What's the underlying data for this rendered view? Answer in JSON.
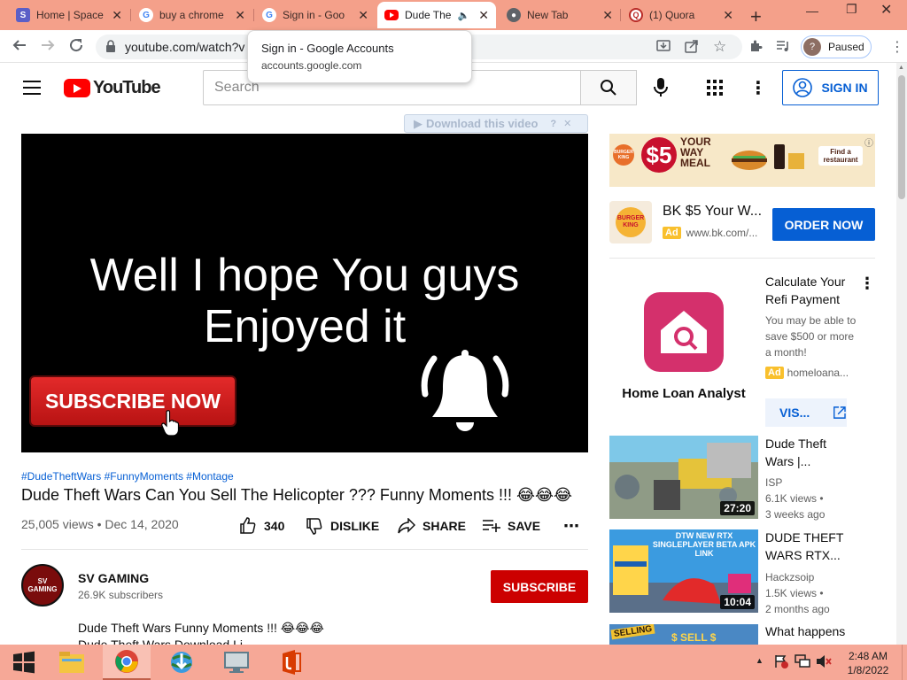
{
  "browser": {
    "tabs": [
      {
        "title": "Home | Space",
        "icon": "teams-icon"
      },
      {
        "title": "buy a chrome",
        "icon": "google-icon"
      },
      {
        "title": "Sign in - Goo",
        "icon": "google-icon"
      },
      {
        "title": "Dude The",
        "icon": "youtube-icon",
        "active": true,
        "audio": true
      },
      {
        "title": "New Tab",
        "icon": "chrome-icon"
      },
      {
        "title": "(1) Quora",
        "icon": "quora-icon"
      }
    ],
    "url": "youtube.com/watch?v",
    "profile_label": "Paused",
    "profile_initial": "?",
    "tooltip": {
      "title": "Sign in - Google Accounts",
      "url": "accounts.google.com"
    }
  },
  "youtube": {
    "logo_text": "YouTube",
    "search_placeholder": "Search",
    "sign_in_label": "SIGN IN",
    "download_bar": "Download this video",
    "video": {
      "overlay_line1": "Well I hope You guys",
      "overlay_line2": "Enjoyed it",
      "subscribe_overlay": "SUBSCRIBE NOW",
      "hashtags": "#DudeTheftWars #FunnyMoments #Montage",
      "title": "Dude Theft Wars Can You Sell The Helicopter ??? Funny Moments !!! 😂😂😂",
      "views_date": "25,005 views • Dec 14, 2020",
      "like_count": "340",
      "dislike_label": "DISLIKE",
      "share_label": "SHARE",
      "save_label": "SAVE"
    },
    "channel": {
      "name": "SV GAMING",
      "subscribers": "26.9K subscribers",
      "subscribe_label": "SUBSCRIBE",
      "avatar_text": "SV GAMING"
    },
    "description": {
      "line1": "Dude Theft Wars Funny Moments !!! 😂😂😂",
      "line2": "Dude Theft Wars Download Li..."
    }
  },
  "ads": {
    "banner": {
      "brand": "BURGER KING",
      "price": "$5",
      "headline1": "YOUR",
      "headline2": "WAY",
      "headline3": "MEAL",
      "cta": "Find a restaurant"
    },
    "bk": {
      "title": "BK $5 Your W...",
      "badge": "Ad",
      "url": "www.bk.com/...",
      "cta": "ORDER NOW",
      "logo_text": "BURGER KING"
    },
    "homeloan": {
      "brand": "Home Loan Analyst",
      "title": "Calculate Your Refi Payment",
      "desc": "You may be able to save $500 or more a month!",
      "badge": "Ad",
      "url": "homeloana...",
      "cta": "VIS..."
    }
  },
  "related": [
    {
      "title": "Dude Theft Wars |...",
      "channel": "ISP",
      "views": "6.1K views •",
      "age": "3 weeks ago",
      "duration": "27:20"
    },
    {
      "title": "DUDE THEFT WARS RTX...",
      "channel": "Hackzsoip",
      "views": "1.5K views •",
      "age": "2 months ago",
      "duration": "10:04",
      "thumb_text": "DTW NEW RTX SINGLEPLAYER BETA APK LINK"
    },
    {
      "title": "What happens",
      "thumb_text1": "SELLING",
      "thumb_text2": "$ SELL $"
    }
  ],
  "taskbar": {
    "time": "2:48 AM",
    "date": "1/8/2022"
  },
  "colors": {
    "tab_strip": "#f4a08a",
    "youtube_red": "#ff0000",
    "link_blue": "#065fd4",
    "subscribe_red": "#cc0000",
    "taskbar": "#f6a897"
  }
}
